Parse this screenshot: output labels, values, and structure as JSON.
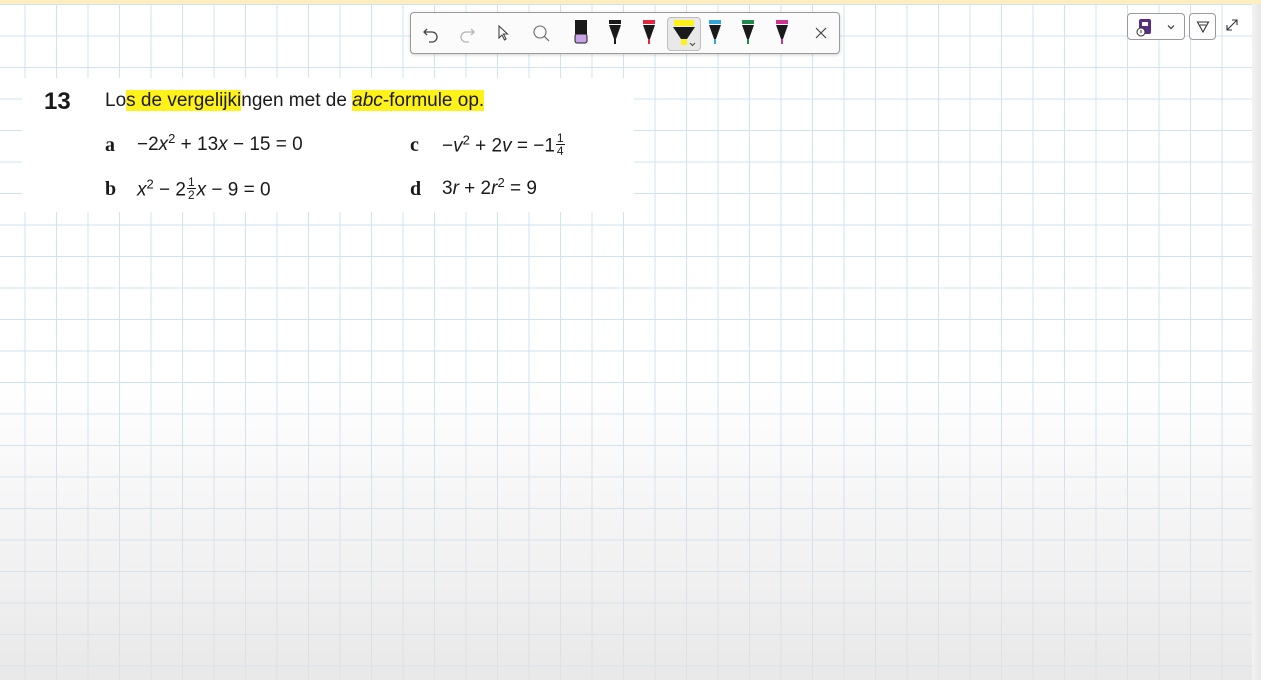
{
  "exercise": {
    "number": "13",
    "title_plain_1": "Lo",
    "title_hl_1": "s de vergelijki",
    "title_plain_2": "ngen met de ",
    "title_hl_2_italic": "abc",
    "title_hl_2_rest": "-formule op.",
    "items": [
      {
        "letter": "a",
        "pre": "−2",
        "var1": "x",
        "exp1": "2",
        "post": " + 13",
        "var2": "x",
        "tail": " − 15 = 0"
      },
      {
        "letter": "b",
        "var1": "x",
        "exp1": "2",
        "mid": " − 2",
        "frac_num": "1",
        "frac_den": "2",
        "var2": "x",
        "tail": " − 9 = 0"
      },
      {
        "letter": "c",
        "pre": "−",
        "var1": "v",
        "exp1": "2",
        "post": " + 2",
        "var2": "v",
        "tail": " = −1",
        "frac_num": "1",
        "frac_den": "4"
      },
      {
        "letter": "d",
        "pre": "3",
        "var1": "r",
        "post": " + 2",
        "var2": "r",
        "exp2": "2",
        "tail": " = 9"
      }
    ]
  },
  "toolbar": {
    "tools": [
      "undo-icon",
      "redo-icon",
      "lasso-select-icon",
      "eraser-icon",
      "pen-purple-icon",
      "pen-black-icon",
      "pen-red-icon",
      "highlighter-yellow-icon",
      "pen-blue-icon",
      "pen-green-icon",
      "pen-magenta-icon",
      "close-icon"
    ],
    "colors": {
      "highlighter": "#fff21b",
      "purple": "#c9a2e8",
      "red": "#e2283c",
      "blue": "#2fa7d8",
      "green": "#1f8a4c",
      "magenta": "#d2328e"
    }
  },
  "controls": {
    "icons": [
      "sticker-icon",
      "chevron-down-icon",
      "filter-icon",
      "expand-icon"
    ]
  }
}
